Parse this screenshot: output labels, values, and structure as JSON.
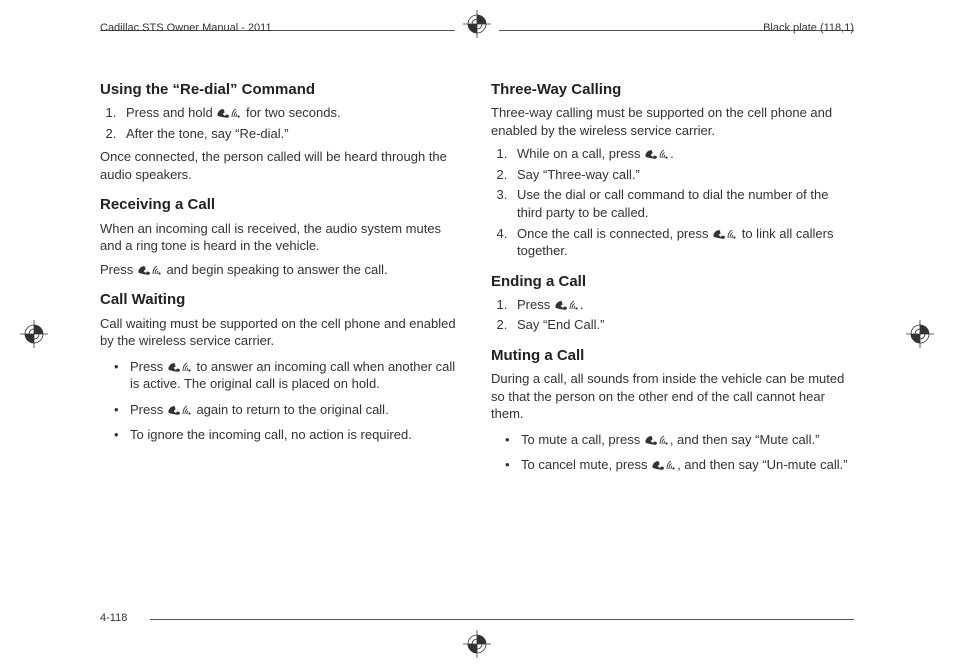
{
  "header": {
    "left": "Cadillac STS Owner Manual - 2011",
    "right": "Black plate (118,1)"
  },
  "footer": {
    "page": "4-118"
  },
  "left_col": {
    "s1_title": "Using the “Re-dial” Command",
    "s1_li1_a": "Press and hold ",
    "s1_li1_b": " for two seconds.",
    "s1_li2": "After the tone, say “Re-dial.”",
    "s1_p": "Once connected, the person called will be heard through the audio speakers.",
    "s2_title": "Receiving a Call",
    "s2_p1": "When an incoming call is received, the audio system mutes and a ring tone is heard in the vehicle.",
    "s2_p2_a": "Press ",
    "s2_p2_b": " and begin speaking to answer the call.",
    "s3_title": "Call Waiting",
    "s3_p": "Call waiting must be supported on the cell phone and enabled by the wireless service carrier.",
    "s3_li1_a": "Press ",
    "s3_li1_b": " to answer an incoming call when another call is active. The original call is placed on hold.",
    "s3_li2_a": "Press ",
    "s3_li2_b": " again to return to the original call.",
    "s3_li3": "To ignore the incoming call, no action is required."
  },
  "right_col": {
    "s4_title": "Three-Way Calling",
    "s4_p": "Three-way calling must be supported on the cell phone and enabled by the wireless service carrier.",
    "s4_li1_a": "While on a call, press ",
    "s4_li1_b": ".",
    "s4_li2": "Say “Three-way call.”",
    "s4_li3": "Use the dial or call command to dial the number of the third party to be called.",
    "s4_li4_a": "Once the call is connected, press ",
    "s4_li4_b": " to link all callers together.",
    "s5_title": "Ending a Call",
    "s5_li1_a": "Press ",
    "s5_li1_b": ".",
    "s5_li2": "Say “End Call.”",
    "s6_title": "Muting a Call",
    "s6_p": "During a call, all sounds from inside the vehicle can be muted so that the person on the other end of the call cannot hear them.",
    "s6_li1_a": "To mute a call, press ",
    "s6_li1_b": ", and then say “Mute call.”",
    "s6_li2_a": "To cancel mute, press ",
    "s6_li2_b": ", and then say “Un-mute call.”"
  }
}
